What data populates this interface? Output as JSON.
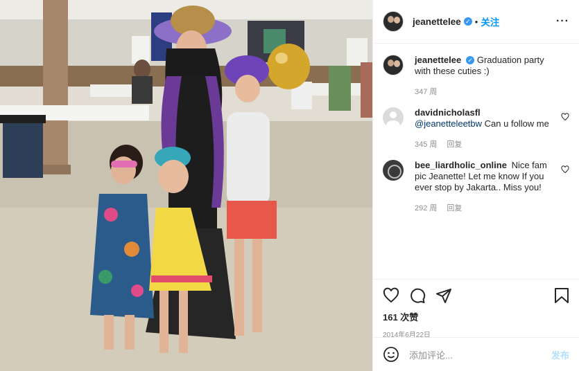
{
  "post": {
    "username": "jeanettelee",
    "follow_label": "关注",
    "caption": "Graduation party with these cuties :)",
    "caption_time": "347 周"
  },
  "comments": [
    {
      "username": "davidnicholasfl",
      "mention": "@jeanetteleetbw",
      "text": " Can u follow me",
      "time": "345 周",
      "reply_label": "回复"
    },
    {
      "username": "bee_liardholic_online",
      "text": "Nice fam pic Jeanette! Let me know If you ever stop by Jakarta.. Miss you!",
      "time": "292 周",
      "reply_label": "回复"
    }
  ],
  "engagement": {
    "likes": "161 次赞",
    "date": "2014年6月22日"
  },
  "add_comment": {
    "placeholder": "添加评论...",
    "post_label": "发布"
  },
  "icons": {
    "verified": "verified-badge-icon",
    "more": "more-options-icon",
    "like": "heart-icon",
    "comment": "comment-icon",
    "share": "share-icon",
    "save": "bookmark-icon",
    "emoji": "emoji-icon"
  },
  "colors": {
    "accent": "#0095f6",
    "post_disabled": "#b2dffc",
    "verified": "#3897f0"
  }
}
